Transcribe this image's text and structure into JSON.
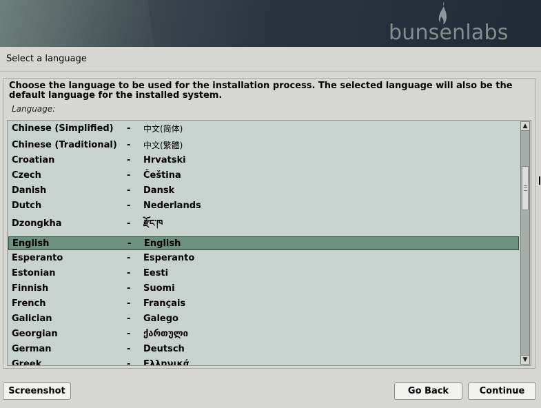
{
  "header": {
    "brand": "bunsenlabs"
  },
  "page": {
    "title": "Select a language",
    "instructions": "Choose the language to be used for the installation process. The selected language will also be the default language for the installed system.",
    "field_label": "Language:"
  },
  "languages": [
    {
      "name": "Chinese (Simplified)",
      "native": "中文(简体)"
    },
    {
      "name": "Chinese (Traditional)",
      "native": "中文(繁體)"
    },
    {
      "name": "Croatian",
      "native": "Hrvatski"
    },
    {
      "name": "Czech",
      "native": "Čeština"
    },
    {
      "name": "Danish",
      "native": "Dansk"
    },
    {
      "name": "Dutch",
      "native": "Nederlands"
    },
    {
      "name": "Dzongkha",
      "native": "རྫོང་ཁ"
    },
    {
      "name": "English",
      "native": "English",
      "selected": true
    },
    {
      "name": "Esperanto",
      "native": "Esperanto"
    },
    {
      "name": "Estonian",
      "native": "Eesti"
    },
    {
      "name": "Finnish",
      "native": "Suomi"
    },
    {
      "name": "French",
      "native": "Français"
    },
    {
      "name": "Galician",
      "native": "Galego"
    },
    {
      "name": "Georgian",
      "native": "ქართული"
    },
    {
      "name": "German",
      "native": "Deutsch"
    },
    {
      "name": "Greek",
      "native": "Ελληνικά"
    }
  ],
  "separator": "-",
  "scrollbar": {
    "up_icon": "▲",
    "down_icon": "▼"
  },
  "buttons": {
    "screenshot": "Screenshot",
    "go_back": "Go Back",
    "continue": "Continue"
  },
  "colors": {
    "selection": "#6e9080",
    "list_background": "#c8d3cf",
    "brand_text": "#7e8f8e"
  }
}
